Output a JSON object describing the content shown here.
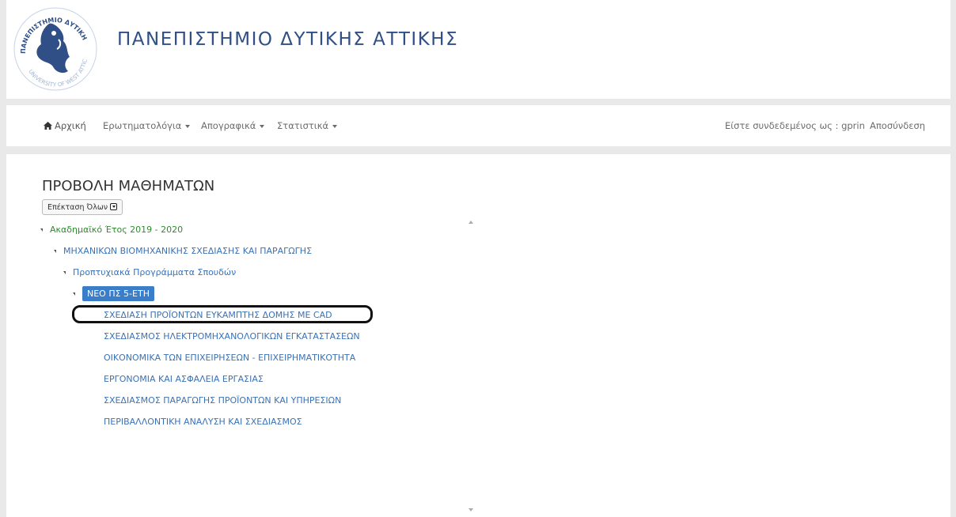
{
  "header": {
    "title": "ΠΑΝΕΠΙΣΤΗΜΙΟ ΔΥΤΙΚΗΣ ΑΤΤΙΚΗΣ",
    "logo_text_top": "ΠΑΝΕΠΙΣΤΗΜΙΟ ΔΥΤΙΚΗΣ ΑΤΤΙΚΗΣ",
    "logo_text_bottom": "UNIVERSITY OF WEST ATTICA",
    "logo_color": "#2f4f86"
  },
  "nav": {
    "home": {
      "icon": "home-icon",
      "label": "Αρχική"
    },
    "questionnaires": "Ερωτηματολόγια",
    "inventories": "Απογραφικά",
    "statistics": "Στατιστικά",
    "logged_in": "Είστε συνδεδεμένος ως : gprin",
    "logout": "Αποσύνδεση"
  },
  "main": {
    "heading": "ΠΡΟΒΟΛΗ ΜΑΘΗΜΑΤΩΝ",
    "expand_all": "Επέκταση Όλων",
    "tree": {
      "year": "Ακαδημαϊκό Έτος 2019 - 2020",
      "department": "ΜΗΧΑΝΙΚΩΝ ΒΙΟΜΗΧΑΝΙΚΗΣ ΣΧΕΔΙΑΣΗΣ ΚΑΙ ΠΑΡΑΓΩΓΗΣ",
      "program_type": "Προπτυχιακά Προγράμματα Σπουδών",
      "program": "ΝΕΟ ΠΣ 5-ΕΤΗ",
      "courses": [
        "ΣΧΕΔΙΑΣΗ ΠΡΟΪΟΝΤΩΝ ΕΥΚΑΜΠΤΗΣ ΔΟΜΗΣ ΜΕ CAD",
        "ΣΧΕΔΙΑΣΜΟΣ ΗΛΕΚΤΡΟΜΗΧΑΝΟΛΟΓΙΚΩΝ ΕΓΚΑΤΑΣΤΑΣΕΩΝ",
        "ΟΙΚΟΝΟΜΙΚΑ ΤΩΝ ΕΠΙΧΕΙΡΗΣΕΩΝ - ΕΠΙΧΕΙΡΗΜΑΤΙΚΟΤΗΤΑ",
        "ΕΡΓΟΝΟΜΙΑ ΚΑΙ ΑΣΦΑΛΕΙΑ ΕΡΓΑΣΙΑΣ",
        "ΣΧΕΔΙΑΣΜΟΣ ΠΑΡΑΓΩΓΗΣ ΠΡΟΪΟΝΤΩΝ ΚΑΙ ΥΠΗΡΕΣΙΩΝ",
        "ΠΕΡΙΒΑΛΛΟΝΤΙΚΗ ΑΝΑΛΥΣΗ ΚΑΙ ΣΧΕΔΙΑΣΜΟΣ"
      ]
    }
  },
  "colors": {
    "link": "#3a72b6",
    "year": "#2e8b2e",
    "selected_bg": "#3a7dc8",
    "background": "#e9e9e9"
  }
}
